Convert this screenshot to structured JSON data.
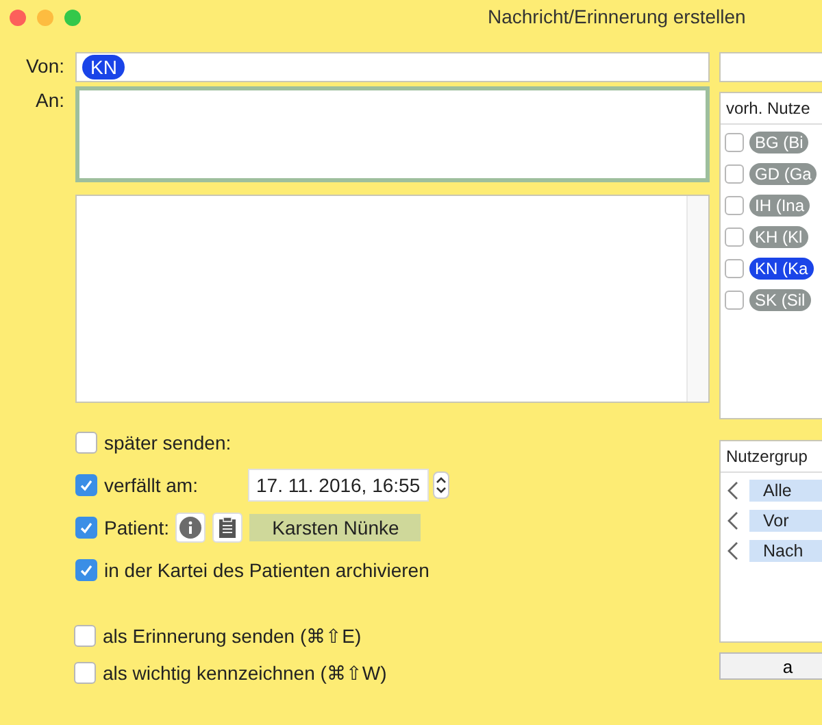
{
  "window": {
    "title": "Nachricht/Erinnerung erstellen"
  },
  "from": {
    "label": "Von:",
    "tokens": [
      {
        "text": "KN",
        "color": "#1a44e8"
      }
    ]
  },
  "to": {
    "label": "An:",
    "focused": true
  },
  "options": [
    {
      "label": "später senden:",
      "checked": false,
      "kind": "plain"
    },
    {
      "label": "verfällt am:",
      "checked": true,
      "kind": "date",
      "value": "17. 11. 2016,  16:55"
    },
    {
      "label": "Patient:",
      "checked": true,
      "kind": "patient",
      "value": "Karsten Nünke"
    },
    {
      "label": "in der Kartei des Patienten archivieren",
      "checked": true,
      "kind": "plain"
    }
  ],
  "flags": [
    {
      "label": "als Erinnerung senden (⌘⇧E)",
      "checked": false
    },
    {
      "label": "als wichtig kennzeichnen (⌘⇧W)",
      "checked": false
    }
  ],
  "users": {
    "header": "vorh. Nutze",
    "items": [
      {
        "label": "BG (Bi",
        "checked": false,
        "color": "#8e9593"
      },
      {
        "label": "GD (Ga",
        "checked": false,
        "color": "#8e9593"
      },
      {
        "label": "IH (Ina",
        "checked": false,
        "color": "#8e9593"
      },
      {
        "label": "KH (Kl",
        "checked": false,
        "color": "#8e9593"
      },
      {
        "label": "KN (Ka",
        "checked": false,
        "color": "#1a44e8"
      },
      {
        "label": "SK (Sil",
        "checked": false,
        "color": "#8e9593"
      }
    ]
  },
  "groups": {
    "header": "Nutzergrup",
    "items": [
      {
        "label": "Alle"
      },
      {
        "label": "Vor"
      },
      {
        "label": "Nach"
      }
    ]
  },
  "side_button": {
    "label": "a"
  }
}
